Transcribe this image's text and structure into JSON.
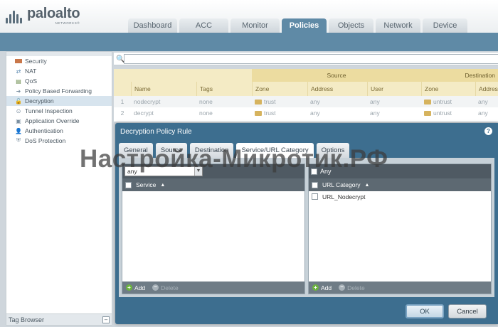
{
  "header": {
    "logo_name": "paloalto",
    "logo_sub": "NETWORKS®",
    "tabs": [
      {
        "label": "Dashboard"
      },
      {
        "label": "ACC"
      },
      {
        "label": "Monitor"
      },
      {
        "label": "Policies"
      },
      {
        "label": "Objects"
      },
      {
        "label": "Network"
      },
      {
        "label": "Device"
      }
    ],
    "active_tab": "Policies"
  },
  "sidebar": {
    "items": [
      {
        "label": "Security",
        "icon": "security-icon"
      },
      {
        "label": "NAT",
        "icon": "nat-icon"
      },
      {
        "label": "QoS",
        "icon": "qos-icon"
      },
      {
        "label": "Policy Based Forwarding",
        "icon": "pbf-icon"
      },
      {
        "label": "Decryption",
        "icon": "decryption-icon"
      },
      {
        "label": "Tunnel Inspection",
        "icon": "tunnel-icon"
      },
      {
        "label": "Application Override",
        "icon": "app-override-icon"
      },
      {
        "label": "Authentication",
        "icon": "authentication-icon"
      },
      {
        "label": "DoS Protection",
        "icon": "dos-icon"
      }
    ],
    "active_item": "Decryption",
    "tag_browser": "Tag Browser"
  },
  "table": {
    "groups": {
      "source": "Source",
      "destination": "Destination"
    },
    "columns": {
      "name": "Name",
      "tags": "Tags",
      "zone": "Zone",
      "address": "Address",
      "user": "User",
      "dzone": "Zone",
      "daddress": "Address"
    },
    "rows": [
      {
        "num": "1",
        "name": "nodecrypt",
        "tags": "none",
        "zone": "trust",
        "address": "any",
        "user": "any",
        "dzone": "untrust",
        "daddress": "any"
      },
      {
        "num": "2",
        "name": "decrypt",
        "tags": "none",
        "zone": "trust",
        "address": "any",
        "user": "any",
        "dzone": "untrust",
        "daddress": "any"
      }
    ]
  },
  "dialog": {
    "title": "Decryption Policy Rule",
    "help": "?",
    "tabs": [
      {
        "label": "General"
      },
      {
        "label": "Source"
      },
      {
        "label": "Destination"
      },
      {
        "label": "Service/URL Category"
      },
      {
        "label": "Options"
      }
    ],
    "active_tab": "Service/URL Category",
    "service_pane": {
      "select_value": "any",
      "header": "Service",
      "add": "Add",
      "delete": "Delete"
    },
    "url_pane": {
      "any_label": "Any",
      "header": "URL Category",
      "items": [
        {
          "label": "URL_Nodecrypt"
        }
      ],
      "add": "Add",
      "delete": "Delete"
    },
    "ok": "OK",
    "cancel": "Cancel"
  },
  "watermark": "Настройка-Микротик.РФ",
  "colors": {
    "accent": "#5f8aa6",
    "dialog": "#3d6e8f",
    "header_tan": "#f4ebc5",
    "add_green": "#6cb33f"
  }
}
